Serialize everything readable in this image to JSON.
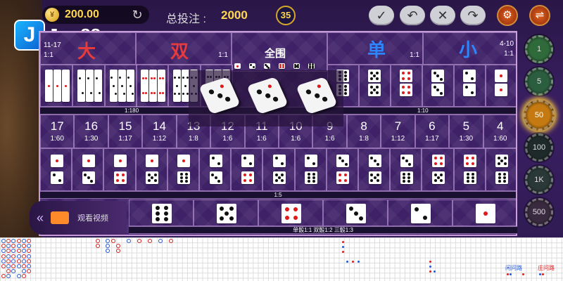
{
  "header": {
    "balance": "200.00",
    "coin_symbol": "¥",
    "bet_label": "总投注 :",
    "bet_amount": "2000",
    "round": "35",
    "refresh_icon": "↻"
  },
  "logo": {
    "badge": "J",
    "text": "Jun88"
  },
  "toolbar": {
    "confirm": "✓",
    "undo": "↶",
    "clear": "✕",
    "redo": "↷"
  },
  "round_buttons": {
    "settings": "⚙",
    "menu": "⇌"
  },
  "top_row": {
    "big": {
      "label": "大",
      "range": "11-17",
      "odds": "1:1"
    },
    "even": {
      "label": "双",
      "odds": "1:1"
    },
    "any_triple": {
      "label": "全围"
    },
    "odd": {
      "label": "单",
      "odds": "1:1"
    },
    "small": {
      "label": "小",
      "range": "4-10",
      "odds": "1:1"
    }
  },
  "strip_labels": {
    "triples": "1:180",
    "specific_triple": "1:10",
    "pairs": "1:5",
    "singles": "单骰1:1 双骰1:2 三骰1:3"
  },
  "sums": [
    {
      "n": "17",
      "odds": "1:60"
    },
    {
      "n": "16",
      "odds": "1:30"
    },
    {
      "n": "15",
      "odds": "1:17"
    },
    {
      "n": "14",
      "odds": "1:12"
    },
    {
      "n": "13",
      "odds": "1:8"
    },
    {
      "n": "12",
      "odds": "1:6"
    },
    {
      "n": "11",
      "odds": "1:6"
    },
    {
      "n": "10",
      "odds": "1:6"
    },
    {
      "n": "9",
      "odds": "1:6"
    },
    {
      "n": "8",
      "odds": "1:8"
    },
    {
      "n": "7",
      "odds": "1:12"
    },
    {
      "n": "6",
      "odds": "1:17"
    },
    {
      "n": "5",
      "odds": "1:30"
    },
    {
      "n": "4",
      "odds": "1:60"
    }
  ],
  "chips": [
    "1",
    "5",
    "50",
    "100",
    "1K",
    "500"
  ],
  "video": {
    "label": "观看视频",
    "arrows": "«"
  },
  "road": {
    "player_label": "闲问路",
    "banker_label": "庄问路"
  },
  "colors": {
    "gold": "#ffd84d",
    "big": "#e53b3b",
    "odd": "#2e86ff",
    "small": "#2e86ff"
  }
}
